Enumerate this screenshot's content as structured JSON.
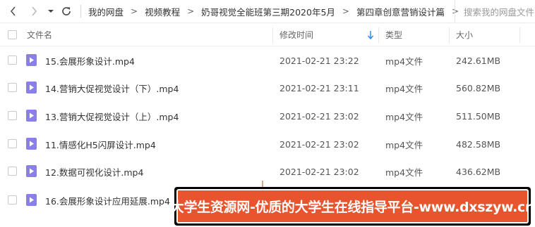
{
  "toolbar": {
    "back_icon": "chevron-left-icon",
    "forward_icon": "chevron-right-icon",
    "history_icon": "triangle-down-icon",
    "refresh_icon": "refresh-icon"
  },
  "breadcrumbs": [
    "我的网盘",
    "视频教程",
    "奶哥视觉全能班第三期2020年5月",
    "第四章创意营销设计篇"
  ],
  "search": {
    "placeholder": "搜索我的网盘文件"
  },
  "columns": {
    "name": "文件名",
    "modified": "修改时间",
    "type": "类型",
    "size": "大小"
  },
  "files": [
    {
      "name": "15.会展形象设计.mp4",
      "modified": "2021-02-21 23:22",
      "type": "mp4文件",
      "size": "242.61MB"
    },
    {
      "name": "14.营销大促视觉设计（下）.mp4",
      "modified": "2021-02-21 23:11",
      "type": "mp4文件",
      "size": "560.82MB"
    },
    {
      "name": "13.营销大促视觉设计（上）.mp4",
      "modified": "2021-02-21 23:02",
      "type": "mp4文件",
      "size": "511.50MB"
    },
    {
      "name": "11.情感化H5闪屏设计.mp4",
      "modified": "2021-02-21 23:02",
      "type": "mp4文件",
      "size": "482.58MB"
    },
    {
      "name": "12.数据可视化设计.mp4",
      "modified": "2021-02-21 23:02",
      "type": "mp4文件",
      "size": "436.62MB"
    },
    {
      "name": "16.会展形象设计应用延展.mp4",
      "modified": "",
      "type": "",
      "size": ""
    }
  ],
  "watermark": {
    "text": "大学生资源网-优质的大学生在线指导平台-www.dxszyw.cn"
  },
  "colors": {
    "video_icon": "#8a7fe8",
    "sort_arrow": "#2f8cf0",
    "banner_bg": "#e8542d"
  }
}
